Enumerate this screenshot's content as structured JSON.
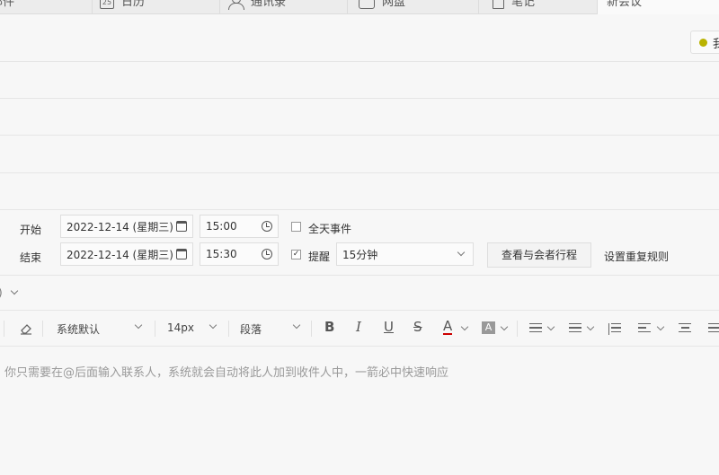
{
  "tabs": [
    {
      "name": "mail",
      "label": "邮件",
      "icon": "mail-icon"
    },
    {
      "name": "calendar",
      "label": "日历",
      "icon": "calendar-icon",
      "icon_text": "25"
    },
    {
      "name": "contacts",
      "label": "通讯录",
      "icon": "contacts-icon"
    },
    {
      "name": "disk",
      "label": "网盘",
      "icon": "disk-icon"
    },
    {
      "name": "notes",
      "label": "笔记",
      "icon": "notes-icon"
    },
    {
      "name": "new-meeting",
      "label": "新会议",
      "active": true
    }
  ],
  "status": {
    "label": "我",
    "dot_color": "#b9b200"
  },
  "start": {
    "label": "开始",
    "date": "2022-12-14 (星期三)",
    "time": "15:00",
    "allday_label": "全天事件",
    "allday_checked": false
  },
  "end": {
    "label": "结束",
    "date": "2022-12-14 (星期三)",
    "time": "15:30",
    "reminder_label": "提醒",
    "reminder_checked": true,
    "reminder_value": "15分钟"
  },
  "actions": {
    "schedule_button": "查看与会者行程",
    "repeat_link": "设置重复规则"
  },
  "misc": {
    "paren": ")"
  },
  "toolbar": {
    "font": "系统默认",
    "size": "14px",
    "paragraph": "段落",
    "bold": "B",
    "italic": "I",
    "underline": "U",
    "strike": "S",
    "font_color": "A",
    "bg_color": "A",
    "font_color_value": "#cc0000"
  },
  "editor": {
    "hint": "你只需要在@后面输入联系人，系统就会自动将此人加到收件人中，一箭必中快速响应"
  }
}
